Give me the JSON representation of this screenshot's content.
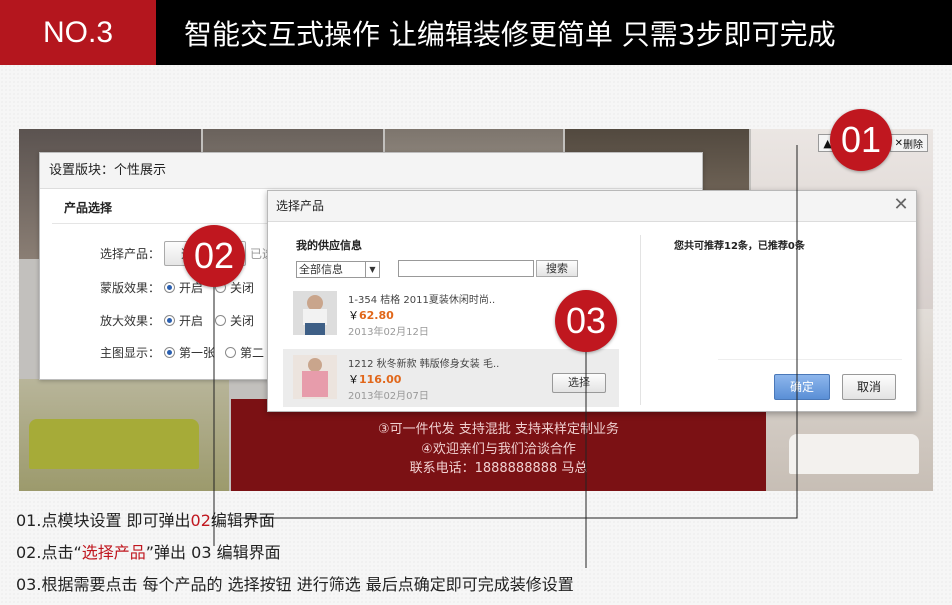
{
  "colors": {
    "accent_red": "#c0171f",
    "header_bg": "#000000",
    "price": "#e1671a",
    "confirm_blue": "#5a8fd6"
  },
  "header": {
    "number": "NO.3",
    "title": "智能交互式操作 让编辑装修更简单 只需3步即可完成"
  },
  "module_tools": {
    "up_icon": "arrow-up-icon",
    "down_icon": "arrow-down-icon",
    "delete_label": "删除"
  },
  "background_text": [
    "③可一件代发  支持混批  支持来样定制业务",
    "④欢迎亲们与我们洽谈合作",
    "联系电话：1888888888  马总"
  ],
  "dialog1": {
    "title": "设置版块：个性展示",
    "section": "产品选择",
    "select_label": "选择产品：",
    "select_button": "选择产品",
    "selected_hint": "已选",
    "mask_label": "蒙版效果：",
    "zoom_label": "放大效果：",
    "main_label": "主图显示：",
    "open": "开启",
    "close": "关闭",
    "first": "第一张",
    "second": "第二"
  },
  "dialog2": {
    "title": "选择产品",
    "close_icon": "close-icon",
    "supply_header": "我的供应信息",
    "filter_value": "全部信息",
    "search_button": "搜索",
    "recommend_text": "您共可推荐12条，已推荐0条",
    "products": [
      {
        "name": "1-354 桔格 2011夏装休闲时尚..",
        "currency": "￥",
        "price": "62.80",
        "date": "2013年02月12日",
        "button": "选择"
      },
      {
        "name": "1212 秋冬新款 韩版修身女装 毛..",
        "currency": "￥",
        "price": "116.00",
        "date": "2013年02月07日",
        "button": "选择"
      }
    ],
    "confirm": "确定",
    "cancel": "取消"
  },
  "markers": {
    "m1": "01",
    "m2": "02",
    "m3": "03"
  },
  "instructions": {
    "line1_a": "01.点模块设置 即可弹出",
    "line1_b": "02",
    "line1_c": "编辑界面",
    "line2_a": "02.点击“",
    "line2_b": "选择产品",
    "line2_c": "”弹出 03 编辑界面",
    "line3": "03.根据需要点击 每个产品的 选择按钮 进行筛选  最后点确定即可完成装修设置"
  }
}
